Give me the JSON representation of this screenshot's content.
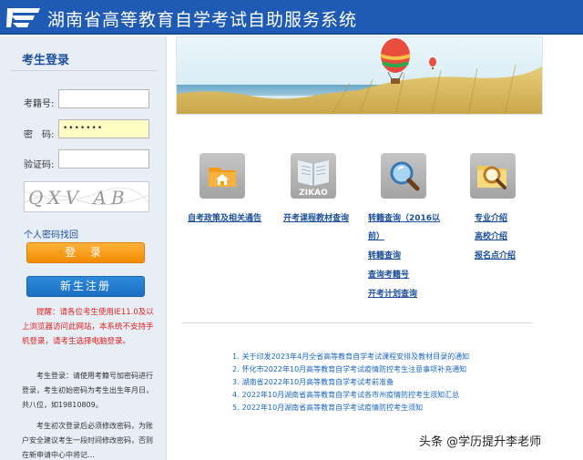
{
  "header": {
    "title": "湖南省高等教育自学考试自助服务系统"
  },
  "login": {
    "title": "考生登录",
    "exam_no_label": "考籍号:",
    "exam_no_value": "",
    "password_label": "密　码:",
    "password_value": "•••••••",
    "captcha_label": "验证码:",
    "captcha_value": "",
    "captcha_image_text": "QXV AB",
    "forgot_link": "个人密码找回",
    "login_button": "登 录",
    "register_button": "新生注册",
    "notice_red": "提醒：请各位考生使用IE11.0及以上浏览器访问此网站，本系统不支持手机登录，请考生选择电脑登录。",
    "notice_login": "考生登录：请使用考籍号加密码进行登录，考生初始密码为考生出生年月日，共八位，如19810809。",
    "notice_first": "考生初次登录后必须修改密码，为账户安全建议考生一段时间修改密码，否则在新申请中心中将记…"
  },
  "tiles": [
    {
      "icon": "folder-home-icon"
    },
    {
      "icon": "zikao-book-icon",
      "caption": "ZIKAO"
    },
    {
      "icon": "magnifier-icon"
    },
    {
      "icon": "magnifier-folder-icon"
    }
  ],
  "links": {
    "policy": "自考政策及相关通告",
    "courses": "开考课程教材查询",
    "transfer_2016_line1": "转籍查询（2016以",
    "transfer_2016_line2": "前）",
    "transfer": "转籍查询",
    "query_exam_no": "查询考籍号",
    "exam_plan": "开考计划查询",
    "major": "专业介绍",
    "university": "高校介绍",
    "registration_points": "报名点介绍"
  },
  "news": [
    {
      "num": "1.",
      "text": "关于印发2023年4月全省高等教育自学考试课程安排及教材目录的通知"
    },
    {
      "num": "2.",
      "text": "怀化市2022年10月高等教育自学考试疫情防控考生注意事项补充通知"
    },
    {
      "num": "3.",
      "text": "湖南省2022年10月高等教育自学考试考前准备"
    },
    {
      "num": "4.",
      "text": "2022年10月湖南省高等教育自学考试各市州疫情防控考生须知汇总"
    },
    {
      "num": "5.",
      "text": "2022年10月湖南省高等教育自学考试疫情防控考生须知"
    }
  ],
  "watermark": "头条 @学历提升李老师",
  "colors": {
    "header": "#1f5bb4",
    "accent_orange": "#f18b00",
    "accent_blue": "#1c6ec2",
    "link": "#1b4f9b",
    "notice_red": "#e02020"
  }
}
